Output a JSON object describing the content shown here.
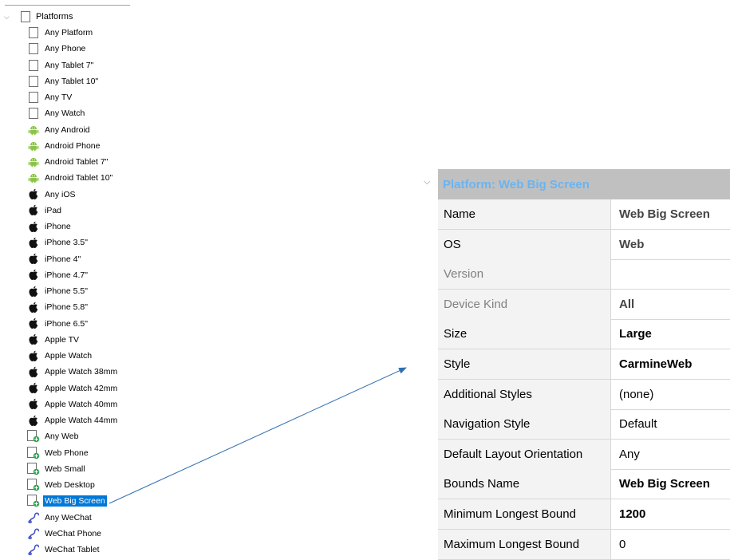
{
  "tree": {
    "root": {
      "label": "Platforms",
      "icon": "device-outline-icon"
    },
    "items": [
      {
        "label": "Any Platform",
        "icon": "device-outline-icon"
      },
      {
        "label": "Any Phone",
        "icon": "device-outline-icon"
      },
      {
        "label": "Any Tablet 7\"",
        "icon": "device-outline-icon"
      },
      {
        "label": "Any Tablet 10\"",
        "icon": "device-outline-icon"
      },
      {
        "label": "Any TV",
        "icon": "device-outline-icon"
      },
      {
        "label": "Any Watch",
        "icon": "device-outline-icon"
      },
      {
        "label": "Any Android",
        "icon": "android-icon"
      },
      {
        "label": "Android Phone",
        "icon": "android-icon"
      },
      {
        "label": "Android Tablet 7\"",
        "icon": "android-icon"
      },
      {
        "label": "Android Tablet 10\"",
        "icon": "android-icon"
      },
      {
        "label": "Any iOS",
        "icon": "apple-icon"
      },
      {
        "label": "iPad",
        "icon": "apple-icon"
      },
      {
        "label": "iPhone",
        "icon": "apple-icon"
      },
      {
        "label": "iPhone 3.5\"",
        "icon": "apple-icon"
      },
      {
        "label": "iPhone 4\"",
        "icon": "apple-icon"
      },
      {
        "label": "iPhone 4.7\"",
        "icon": "apple-icon"
      },
      {
        "label": "iPhone 5.5\"",
        "icon": "apple-icon"
      },
      {
        "label": "iPhone 5.8\"",
        "icon": "apple-icon"
      },
      {
        "label": "iPhone 6.5\"",
        "icon": "apple-icon"
      },
      {
        "label": "Apple TV",
        "icon": "apple-icon"
      },
      {
        "label": "Apple Watch",
        "icon": "apple-icon"
      },
      {
        "label": "Apple Watch 38mm",
        "icon": "apple-icon"
      },
      {
        "label": "Apple Watch 42mm",
        "icon": "apple-icon"
      },
      {
        "label": "Apple Watch 40mm",
        "icon": "apple-icon"
      },
      {
        "label": "Apple Watch 44mm",
        "icon": "apple-icon"
      },
      {
        "label": "Any Web",
        "icon": "web-device-icon"
      },
      {
        "label": "Web Phone",
        "icon": "web-device-icon"
      },
      {
        "label": "Web Small",
        "icon": "web-device-icon"
      },
      {
        "label": "Web Desktop",
        "icon": "web-device-icon"
      },
      {
        "label": "Web Big Screen",
        "icon": "web-device-icon",
        "selected": true
      },
      {
        "label": "Any WeChat",
        "icon": "wechat-icon"
      },
      {
        "label": "WeChat Phone",
        "icon": "wechat-icon"
      },
      {
        "label": "WeChat Tablet",
        "icon": "wechat-icon"
      }
    ]
  },
  "inspector": {
    "title": "Platform: Web Big Screen",
    "rows": [
      {
        "name": "Name",
        "value": "Web Big Screen",
        "name_style": "normal",
        "value_style": "dimbold"
      },
      {
        "name": "OS",
        "value": "Web",
        "name_style": "normal",
        "value_style": "dimbold"
      },
      {
        "name": "Version",
        "value": "",
        "name_style": "dim",
        "value_style": "normal"
      },
      {
        "name": "Device Kind",
        "value": "All",
        "name_style": "dim",
        "value_style": "dimbold"
      },
      {
        "name": "Size",
        "value": "Large",
        "name_style": "normal",
        "value_style": "bold"
      },
      {
        "name": "Style",
        "value": "CarmineWeb",
        "name_style": "normal",
        "value_style": "bold"
      },
      {
        "name": "Additional Styles",
        "value": "(none)",
        "name_style": "normal",
        "value_style": "normal"
      },
      {
        "name": "Navigation Style",
        "value": "Default",
        "name_style": "normal",
        "value_style": "normal"
      },
      {
        "name": "Default Layout Orientation",
        "value": "Any",
        "name_style": "normal",
        "value_style": "normal"
      },
      {
        "name": "Bounds Name",
        "value": "Web Big Screen",
        "name_style": "normal",
        "value_style": "bold"
      },
      {
        "name": "Minimum Longest Bound",
        "value": "1200",
        "name_style": "normal",
        "value_style": "bold"
      },
      {
        "name": "Maximum Longest Bound",
        "value": "0",
        "name_style": "normal",
        "value_style": "normal"
      }
    ]
  },
  "colors": {
    "selection": "#0078d7",
    "header_bg": "#c0c0c0",
    "header_text": "#6ab4f0",
    "android": "#8bc34a",
    "wechat": "#3b4fc4",
    "arrow": "#2f6fb3"
  }
}
